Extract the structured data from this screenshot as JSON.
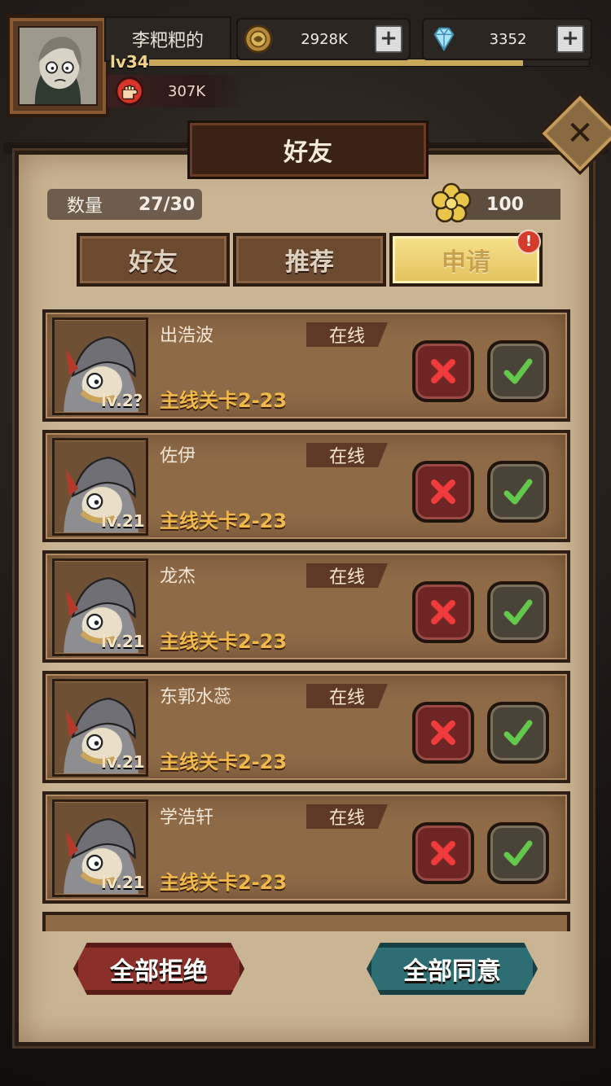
{
  "player": {
    "name": "李粑粑的",
    "level": "lv34",
    "xp_fraction": 0.85,
    "power": "307K"
  },
  "currency": {
    "gold": "2928K",
    "diamond": "3352"
  },
  "panel": {
    "title": "好友",
    "count_label": "数量",
    "count_value": "27/30",
    "flower_value": "100"
  },
  "tabs": [
    {
      "label": "好友",
      "active": false
    },
    {
      "label": "推荐",
      "active": false
    },
    {
      "label": "申请",
      "active": true
    }
  ],
  "requests_badge": "!",
  "requests": [
    {
      "name": "出浩波",
      "status": "在线",
      "stage": "主线关卡2-23",
      "level": "lv.2?"
    },
    {
      "name": "佐伊",
      "status": "在线",
      "stage": "主线关卡2-23",
      "level": "lv.21"
    },
    {
      "name": "龙杰",
      "status": "在线",
      "stage": "主线关卡2-23",
      "level": "lv.21"
    },
    {
      "name": "东郭水蕊",
      "status": "在线",
      "stage": "主线关卡2-23",
      "level": "lv.21"
    },
    {
      "name": "学浩轩",
      "status": "在线",
      "stage": "主线关卡2-23",
      "level": "lv.21"
    }
  ],
  "actions": {
    "reject_all": "全部拒绝",
    "accept_all": "全部同意"
  },
  "colors": {
    "panel_bg": "#c9b493",
    "row_bg": "#8e6a47",
    "stage_text": "#f0b94a",
    "active_tab": "#f6e28c"
  }
}
